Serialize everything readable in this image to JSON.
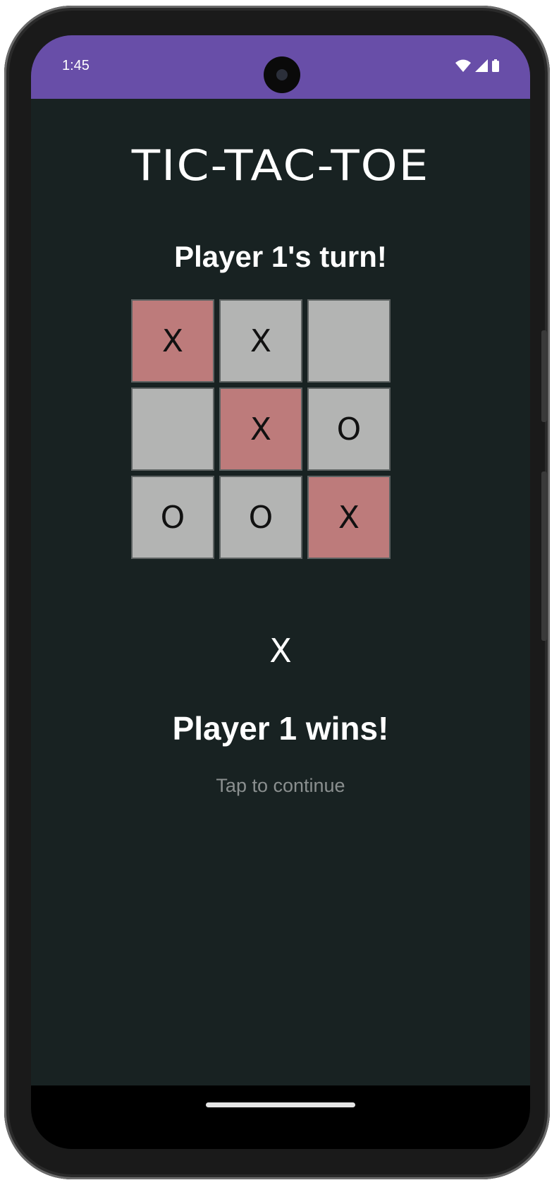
{
  "status_bar": {
    "time": "1:45",
    "icons": [
      "wifi-icon",
      "signal-icon",
      "battery-icon"
    ],
    "color": "#684ea8"
  },
  "app": {
    "logo": "TIC-TAC-TOE",
    "turn_message": "Player 1's turn!"
  },
  "board": {
    "cells": [
      {
        "mark": "X",
        "highlighted": true
      },
      {
        "mark": "X",
        "highlighted": false
      },
      {
        "mark": "",
        "highlighted": false
      },
      {
        "mark": "",
        "highlighted": false
      },
      {
        "mark": "X",
        "highlighted": true
      },
      {
        "mark": "O",
        "highlighted": false
      },
      {
        "mark": "O",
        "highlighted": false
      },
      {
        "mark": "O",
        "highlighted": false
      },
      {
        "mark": "X",
        "highlighted": true
      }
    ],
    "cell_color": "#b3b4b3",
    "win_color": "#bd7b7b"
  },
  "result": {
    "winner_mark": "X",
    "winner_text": "Player 1 wins!",
    "continue_hint": "Tap to continue"
  }
}
